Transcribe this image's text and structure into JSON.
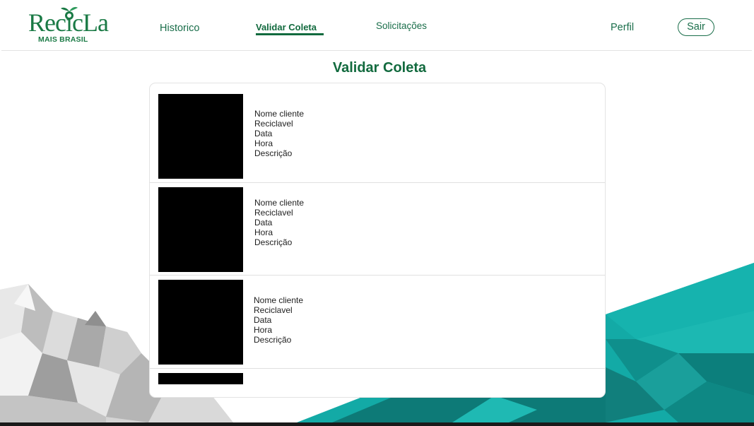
{
  "logo": {
    "word": "RecicLa",
    "sub": "MAIS BRASIL"
  },
  "nav": {
    "historico": "Historico",
    "validar_coleta": "Validar Coleta",
    "solicitacoes": "Solicitações",
    "perfil": "Perfil",
    "sair": "Sair"
  },
  "page": {
    "title": "Validar Coleta"
  },
  "records": [
    {
      "cliente": "Nome cliente",
      "reciclavel": "Reciclavel",
      "data": "Data",
      "hora": "Hora",
      "descricao": "Descrição"
    },
    {
      "cliente": "Nome cliente",
      "reciclavel": "Reciclavel",
      "data": "Data",
      "hora": "Hora",
      "descricao": "Descrição"
    },
    {
      "cliente": "Nome cliente",
      "reciclavel": "Reciclavel",
      "data": "Data",
      "hora": "Hora",
      "descricao": "Descrição"
    }
  ],
  "colors": {
    "brand_green": "#126a3e",
    "teal": "#13aaa6",
    "thumbnail": "#000000"
  }
}
